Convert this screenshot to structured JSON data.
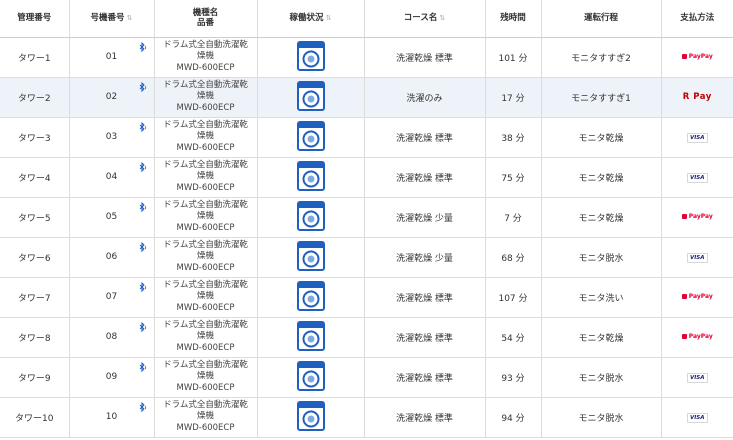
{
  "headers": {
    "mgmt": "管理番号",
    "unit": "号機番号",
    "model_line1": "機種名",
    "model_line2": "品番",
    "status": "稼働状況",
    "course": "コース名",
    "remaining": "残時間",
    "process": "運転行程",
    "payment": "支払方法",
    "sort_icon": "sort-icon"
  },
  "rows": [
    {
      "mgmt": "タワー1",
      "unit": "01",
      "name1": "ドラム式全自動洗濯乾",
      "name2": "燥機",
      "model": "MWD-600ECP",
      "course": "洗濯乾燥 標準",
      "remaining": "101 分",
      "process": "モニタすすぎ2",
      "payment": "PayPay"
    },
    {
      "mgmt": "タワー2",
      "unit": "02",
      "name1": "ドラム式全自動洗濯乾",
      "name2": "燥機",
      "model": "MWD-600ECP",
      "course": "洗濯のみ",
      "remaining": "17 分",
      "process": "モニタすすぎ1",
      "payment": "R Pay"
    },
    {
      "mgmt": "タワー3",
      "unit": "03",
      "name1": "ドラム式全自動洗濯乾",
      "name2": "燥機",
      "model": "MWD-600ECP",
      "course": "洗濯乾燥 標準",
      "remaining": "38 分",
      "process": "モニタ乾燥",
      "payment": "VISA"
    },
    {
      "mgmt": "タワー4",
      "unit": "04",
      "name1": "ドラム式全自動洗濯乾",
      "name2": "燥機",
      "model": "MWD-600ECP",
      "course": "洗濯乾燥 標準",
      "remaining": "75 分",
      "process": "モニタ乾燥",
      "payment": "VISA"
    },
    {
      "mgmt": "タワー5",
      "unit": "05",
      "name1": "ドラム式全自動洗濯乾",
      "name2": "燥機",
      "model": "MWD-600ECP",
      "course": "洗濯乾燥 少量",
      "remaining": "7 分",
      "process": "モニタ乾燥",
      "payment": "PayPay"
    },
    {
      "mgmt": "タワー6",
      "unit": "06",
      "name1": "ドラム式全自動洗濯乾",
      "name2": "燥機",
      "model": "MWD-600ECP",
      "course": "洗濯乾燥 少量",
      "remaining": "68 分",
      "process": "モニタ脱水",
      "payment": "VISA"
    },
    {
      "mgmt": "タワー7",
      "unit": "07",
      "name1": "ドラム式全自動洗濯乾",
      "name2": "燥機",
      "model": "MWD-600ECP",
      "course": "洗濯乾燥 標準",
      "remaining": "107 分",
      "process": "モニタ洗い",
      "payment": "PayPay"
    },
    {
      "mgmt": "タワー8",
      "unit": "08",
      "name1": "ドラム式全自動洗濯乾",
      "name2": "燥機",
      "model": "MWD-600ECP",
      "course": "洗濯乾燥 標準",
      "remaining": "54 分",
      "process": "モニタ乾燥",
      "payment": "PayPay"
    },
    {
      "mgmt": "タワー9",
      "unit": "09",
      "name1": "ドラム式全自動洗濯乾",
      "name2": "燥機",
      "model": "MWD-600ECP",
      "course": "洗濯乾燥 標準",
      "remaining": "93 分",
      "process": "モニタ脱水",
      "payment": "VISA"
    },
    {
      "mgmt": "タワー10",
      "unit": "10",
      "name1": "ドラム式全自動洗濯乾",
      "name2": "燥機",
      "model": "MWD-600ECP",
      "course": "洗濯乾燥 標準",
      "remaining": "94 分",
      "process": "モニタ脱水",
      "payment": "VISA"
    }
  ],
  "highlight_row": 1,
  "colors": {
    "washer_blue": "#1f5fbf",
    "paypay_red": "#e60033",
    "rpay_red": "#bf0000",
    "visa_navy": "#1a1f71",
    "bluetooth_blue": "#1f5fbf",
    "row_highlight": "#eef3f9"
  },
  "icons": {
    "status": "washing-machine-icon",
    "connection": "bluetooth-icon"
  }
}
